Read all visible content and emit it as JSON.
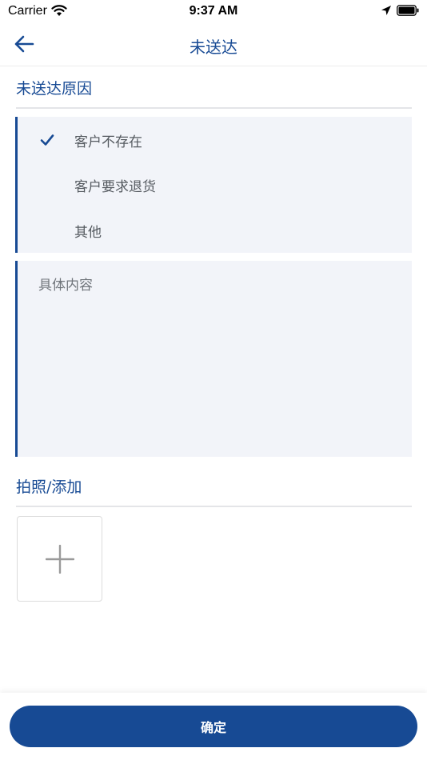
{
  "status_bar": {
    "carrier": "Carrier",
    "time": "9:37 AM"
  },
  "nav": {
    "title": "未送达"
  },
  "reason_section": {
    "title": "未送达原因",
    "options": [
      {
        "label": "客户不存在",
        "selected": true
      },
      {
        "label": "客户要求退货",
        "selected": false
      },
      {
        "label": "其他",
        "selected": false
      }
    ]
  },
  "detail": {
    "placeholder": "具体内容",
    "value": ""
  },
  "photo_section": {
    "title": "拍照/添加"
  },
  "footer": {
    "confirm_label": "确定"
  },
  "colors": {
    "accent": "#174a94",
    "panel_bg": "#f2f4f9",
    "option_text": "#555a60"
  },
  "icons": {
    "back": "arrow-left-icon",
    "check": "checkmark-icon",
    "add": "plus-icon"
  }
}
